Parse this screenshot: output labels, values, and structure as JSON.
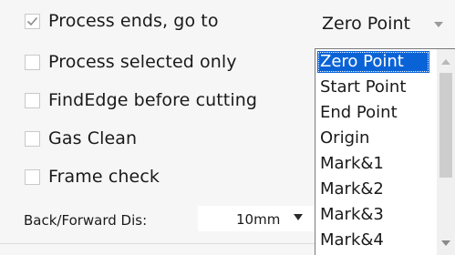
{
  "options": [
    {
      "label": "Process ends, go to",
      "checked": true
    },
    {
      "label": "Process selected only",
      "checked": false
    },
    {
      "label": "FindEdge before cutting",
      "checked": false
    },
    {
      "label": "Gas Clean",
      "checked": false
    },
    {
      "label": "Frame check",
      "checked": false
    }
  ],
  "end_position": {
    "selected": "Zero Point",
    "options": [
      "Zero Point",
      "Start Point",
      "End Point",
      "Origin",
      "Mark&1",
      "Mark&2",
      "Mark&3",
      "Mark&4"
    ]
  },
  "back_forward": {
    "label": "Back/Forward Dis:",
    "value": "10mm"
  }
}
